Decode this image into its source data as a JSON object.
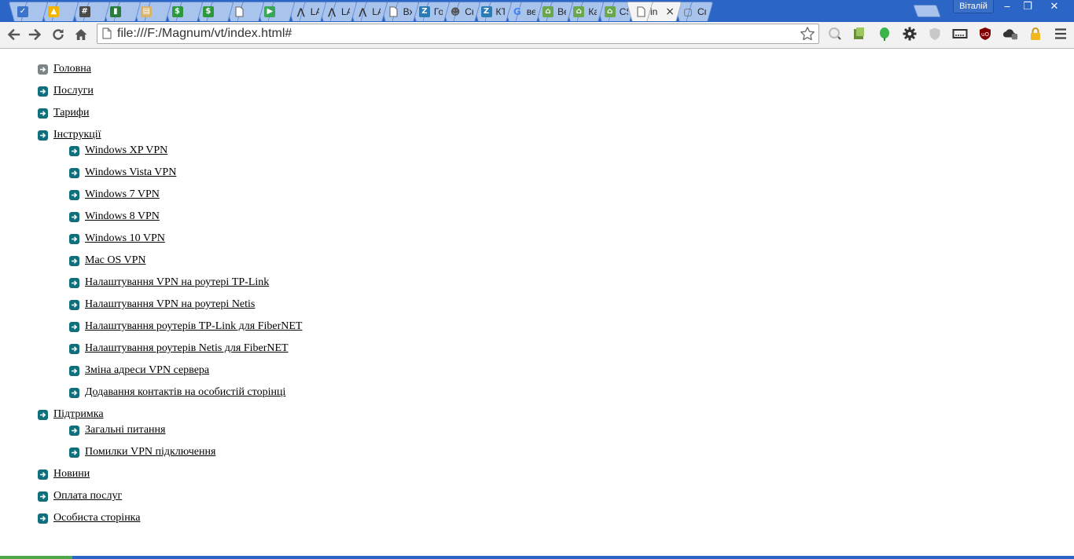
{
  "browser": {
    "tabs": [
      {
        "title": "",
        "favicon": "compose-icon",
        "color": "#3b74c9",
        "glyph": "✓"
      },
      {
        "title": "",
        "favicon": "drive-icon",
        "color": "#f3b400",
        "glyph": "▲"
      },
      {
        "title": "",
        "favicon": "hash-icon",
        "color": "#4a4a4a",
        "glyph": "#"
      },
      {
        "title": "",
        "favicon": "chart-icon",
        "color": "#2b7a3e",
        "glyph": "▮"
      },
      {
        "title": "",
        "favicon": "notes-icon",
        "color": "#d9b36b",
        "glyph": "▤"
      },
      {
        "title": "",
        "favicon": "dollar-icon",
        "color": "#2c9a3c",
        "glyph": "$"
      },
      {
        "title": "",
        "favicon": "dollar-icon",
        "color": "#2c9a3c",
        "glyph": "$"
      },
      {
        "title": "",
        "favicon": "page-icon",
        "color": "#ffffff",
        "glyph": ""
      },
      {
        "title": "",
        "favicon": "green-leaf-icon",
        "color": "#3aa65a",
        "glyph": "▶"
      },
      {
        "title": "LANB",
        "favicon": "lan-icon",
        "color": "#333333",
        "glyph": "⋀"
      },
      {
        "title": "LANB",
        "favicon": "lan-icon",
        "color": "#333333",
        "glyph": "⋀"
      },
      {
        "title": "LANB",
        "favicon": "lan-icon",
        "color": "#333333",
        "glyph": "⋀"
      },
      {
        "title": "Вход",
        "favicon": "page-icon",
        "color": "#ffffff",
        "glyph": ""
      },
      {
        "title": "Голо",
        "favicon": "z-icon",
        "color": "#2a7ab5",
        "glyph": "Z"
      },
      {
        "title": "Скач",
        "favicon": "octocat-icon",
        "color": "#555555",
        "glyph": "☻"
      },
      {
        "title": "КТВ з",
        "favicon": "z-icon",
        "color": "#2a7ab5",
        "glyph": "Z"
      },
      {
        "title": "верт",
        "favicon": "google-icon",
        "color": "#4285f4",
        "glyph": "G"
      },
      {
        "title": "Верт",
        "favicon": "house-icon",
        "color": "#6aa84f",
        "glyph": "⌂"
      },
      {
        "title": "Как с",
        "favicon": "house-icon",
        "color": "#6aa84f",
        "glyph": "⌂"
      },
      {
        "title": "CSS |",
        "favicon": "house-icon",
        "color": "#6aa84f",
        "glyph": "⌂"
      },
      {
        "title": "in",
        "favicon": "page-icon",
        "color": "#ffffff",
        "glyph": "",
        "active": true
      },
      {
        "title": "Спра",
        "favicon": "chat-icon",
        "color": "#555555",
        "glyph": "▢"
      }
    ],
    "profile_name": "Віталій",
    "window_controls": {
      "minimize": "‒",
      "maximize": "❐",
      "close": "✕"
    },
    "address": "file:///F:/Magnum/vt/index.html#",
    "extensions": [
      "search-icon",
      "evernote-save-icon",
      "green-leaf-icon",
      "gear-icon",
      "shield-icon",
      "card-icon",
      "ublock-icon",
      "cloud-icon",
      "lock-icon",
      "menu-icon"
    ]
  },
  "menu": {
    "glavna": "Головна",
    "posluhy": "Послуги",
    "taryfy": "Тарифи",
    "instrukcii": "Інструкції",
    "instrukcii_items": [
      "Windows XP VPN",
      "Windows Vista VPN",
      "Windows 7 VPN",
      "Windows 8 VPN",
      "Windows 10 VPN",
      "Mac OS VPN",
      "Налаштування VPN на роутері TP-Link",
      "Налаштування VPN на роутері Netis",
      "Налаштування роутерів TP-Link для FiberNET",
      "Налаштування роутерів Netis для FiberNET",
      "Зміна адреси VPN сервера",
      "Додавання контактів на особистій сторінці"
    ],
    "pidtrymka": "Підтримка",
    "pidtrymka_items": [
      "Загальні питання",
      "Помилки VPN підключення"
    ],
    "novyny": "Новини",
    "oplata": "Оплата послуг",
    "osobysta": "Особиста сторінка"
  }
}
